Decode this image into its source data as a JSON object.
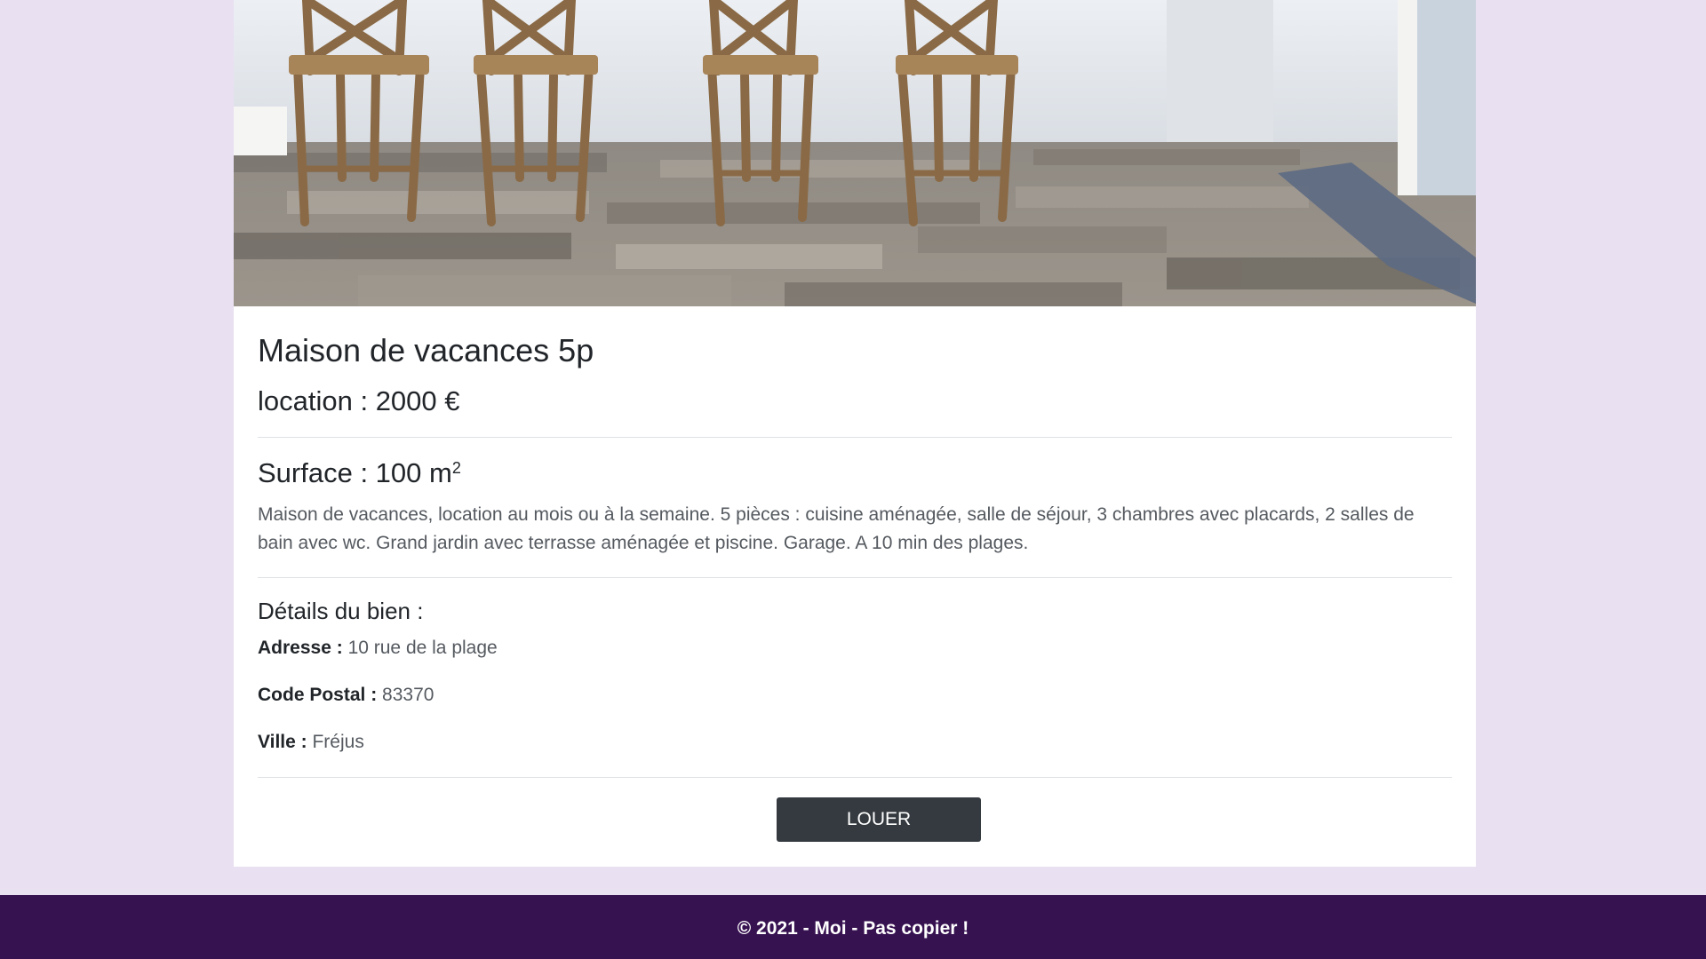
{
  "listing": {
    "image_alt": "Cuisine avec chaises de bar et parquet",
    "title": "Maison de vacances 5p",
    "price": "location : 2000 €",
    "surface_label": "Surface : 100 m",
    "surface_exp": "2",
    "description": "Maison de vacances, location au mois ou à la semaine. 5 pièces : cuisine aménagée, salle de séjour, 3 chambres avec placards, 2 salles de bain avec wc. Grand jardin avec terrasse aménagée et piscine. Garage. A 10 min des plages.",
    "details_title": "Détails du bien :",
    "details": {
      "address_label": "Adresse :",
      "address_value": "10 rue de la plage",
      "postal_label": "Code Postal :",
      "postal_value": "83370",
      "city_label": "Ville :",
      "city_value": "Fréjus"
    },
    "rent_button": "LOUER"
  },
  "footer": {
    "text": "© 2021 - Moi - Pas copier !"
  },
  "colors": {
    "page_background": "#e9e0f2",
    "card_background": "#ffffff",
    "button_background": "#343a40",
    "footer_background": "#371251"
  }
}
